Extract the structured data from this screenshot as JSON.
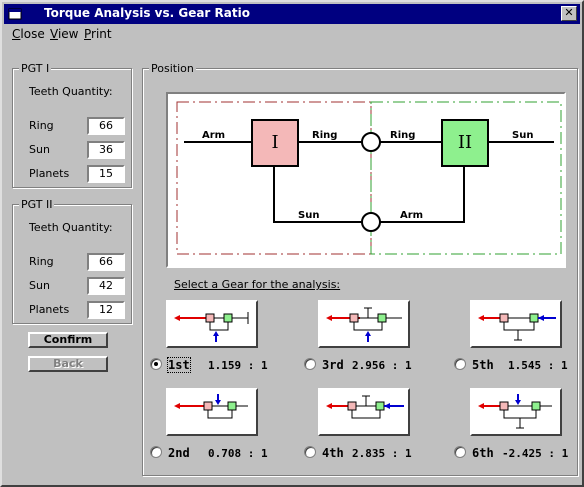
{
  "window": {
    "title": "Torque Analysis vs. Gear Ratio",
    "close_glyph": "✕"
  },
  "menu": [
    "Close",
    "View",
    "Print"
  ],
  "pgt1": {
    "legend": "PGT I",
    "heading": "Teeth Quantity:",
    "rows": [
      {
        "label": "Ring",
        "value": "66"
      },
      {
        "label": "Sun",
        "value": "36"
      },
      {
        "label": "Planets",
        "value": "15"
      }
    ]
  },
  "pgt2": {
    "legend": "PGT II",
    "heading": "Teeth Quantity:",
    "rows": [
      {
        "label": "Ring",
        "value": "66"
      },
      {
        "label": "Sun",
        "value": "42"
      },
      {
        "label": "Planets",
        "value": "12"
      }
    ]
  },
  "buttons": {
    "confirm": "Confirm",
    "back": "Back"
  },
  "position": {
    "legend": "Position",
    "diagram": {
      "box1": "I",
      "box2": "II",
      "labels": {
        "arm_left": "Arm",
        "ring_1": "Ring",
        "ring_2": "Ring",
        "sun_right": "Sun",
        "sun_bottom": "Sun",
        "arm_bottom": "Arm"
      },
      "colors": {
        "box1": "#f4b8b8",
        "box2": "#8ef08e",
        "left_dash": "#a03030",
        "right_dash": "#30a030"
      }
    },
    "select_label": "Select a Gear for the analysis:",
    "gears": [
      {
        "name": "1st",
        "ratio": "1.159 : 1",
        "selected": true
      },
      {
        "name": "3rd",
        "ratio": "2.956 : 1",
        "selected": false
      },
      {
        "name": "5th",
        "ratio": "1.545 : 1",
        "selected": false
      },
      {
        "name": "2nd",
        "ratio": "0.708 : 1",
        "selected": false
      },
      {
        "name": "4th",
        "ratio": "2.835 : 1",
        "selected": false
      },
      {
        "name": "6th",
        "ratio": "-2.425 : 1",
        "selected": false
      }
    ]
  }
}
